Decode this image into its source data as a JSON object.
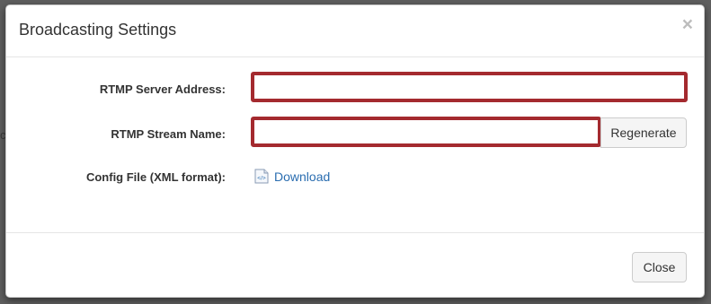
{
  "modal": {
    "title": "Broadcasting Settings",
    "close_glyph": "×"
  },
  "form": {
    "rtmp_server_label": "RTMP Server Address:",
    "rtmp_server_value": "",
    "rtmp_stream_label": "RTMP Stream Name:",
    "rtmp_stream_value": "",
    "regenerate_label": "Regenerate",
    "config_file_label": "Config File (XML format):",
    "download_label": "Download",
    "download_icon": "xml-file-icon"
  },
  "footer": {
    "close_label": "Close"
  },
  "colors": {
    "input_highlight": "#a42a2f",
    "link": "#2a6db0",
    "overlay": "#5f5f5f"
  }
}
